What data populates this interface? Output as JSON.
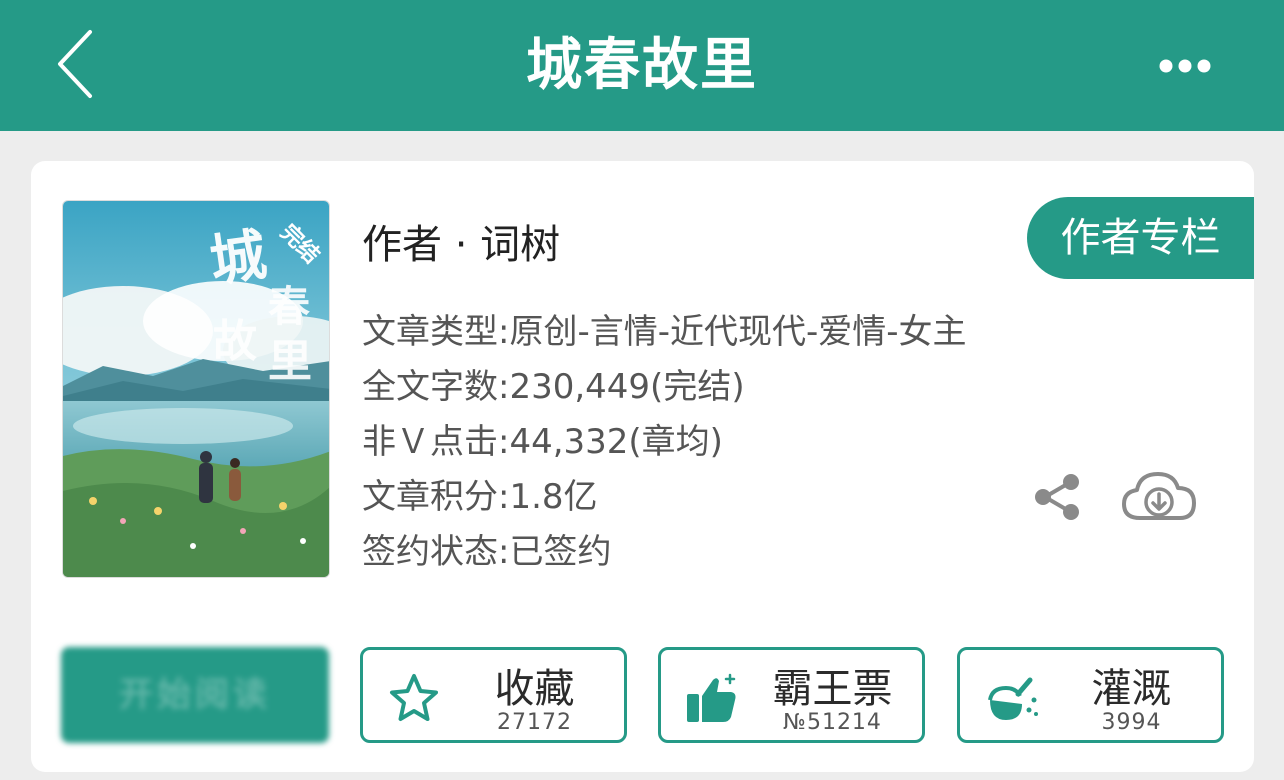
{
  "header": {
    "title": "城春故里",
    "back_icon": "chevron-left-icon",
    "more_icon": "more-horizontal-icon",
    "bg_color": "#259a87"
  },
  "book": {
    "author_line": "作者 · 词树",
    "author_column_label": "作者专栏",
    "cover_badge": "完结",
    "cover_title": "城春故里",
    "info": [
      "文章类型:原创-言情-近代现代-爱情-女主",
      "全文字数:230,449(完结)",
      "非Ｖ点击:44,332(章均)",
      "文章积分:1.8亿",
      "签约状态:已签约"
    ]
  },
  "actions": {
    "read_label": "开始阅读",
    "favorite": {
      "label": "收藏",
      "count": "27172",
      "icon": "star-icon"
    },
    "vote": {
      "label": "霸王票",
      "count": "№51214",
      "icon": "thumbs-up-icon"
    },
    "water": {
      "label": "灌溉",
      "count": "3994",
      "icon": "flask-icon"
    },
    "share_icon": "share-icon",
    "download_icon": "cloud-download-icon"
  },
  "colors": {
    "accent": "#259a87",
    "badge": "#e2552a"
  }
}
